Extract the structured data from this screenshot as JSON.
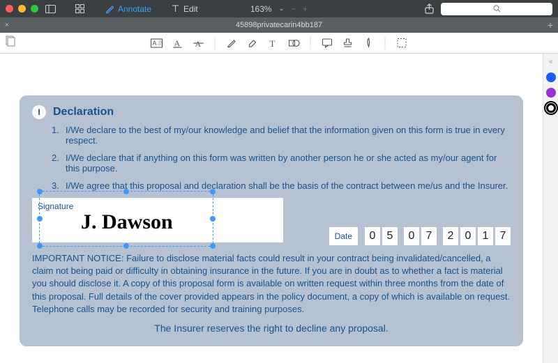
{
  "titlebar": {
    "modes": {
      "annotate": "Annotate",
      "edit": "Edit"
    },
    "zoom": {
      "value": "163%",
      "sep": "—"
    }
  },
  "tab": {
    "title": "45898privatecarin4bb187"
  },
  "rail": {
    "colors": [
      "#1e5cff",
      "#9b2fd6",
      "#000000"
    ],
    "selected": 2
  },
  "decl": {
    "badge": "I",
    "title": "Declaration",
    "items": [
      "I/We declare to the best of my/our knowledge and belief that the information given on this form is true in every respect.",
      "I/We declare that if anything on this form was written by another person he or she acted as my/our agent for this purpose.",
      "I/We agree that this proposal and declaration shall be the basis of the contract between me/us and the Insurer."
    ],
    "signature": {
      "label": "Signature",
      "value": "J. Dawson"
    },
    "date": {
      "label": "Date",
      "groups": [
        [
          "0",
          "5"
        ],
        [
          "0",
          "7"
        ],
        [
          "2",
          "0",
          "1",
          "7"
        ]
      ]
    },
    "notice": "IMPORTANT NOTICE: Failure to disclose material facts could result in your contract being invalidated/cancelled, a claim not being paid or difficulty in obtaining insurance in the future. If you are in doubt as to whether a fact is material you should disclose it. A copy of this proposal form is available on written request within three months from the date of this proposal. Full details of the cover provided appears in the policy document, a copy of which is available on request. Telephone calls may be recorded for security and training purposes.",
    "notice_final": "The Insurer reserves the right to decline any proposal."
  }
}
